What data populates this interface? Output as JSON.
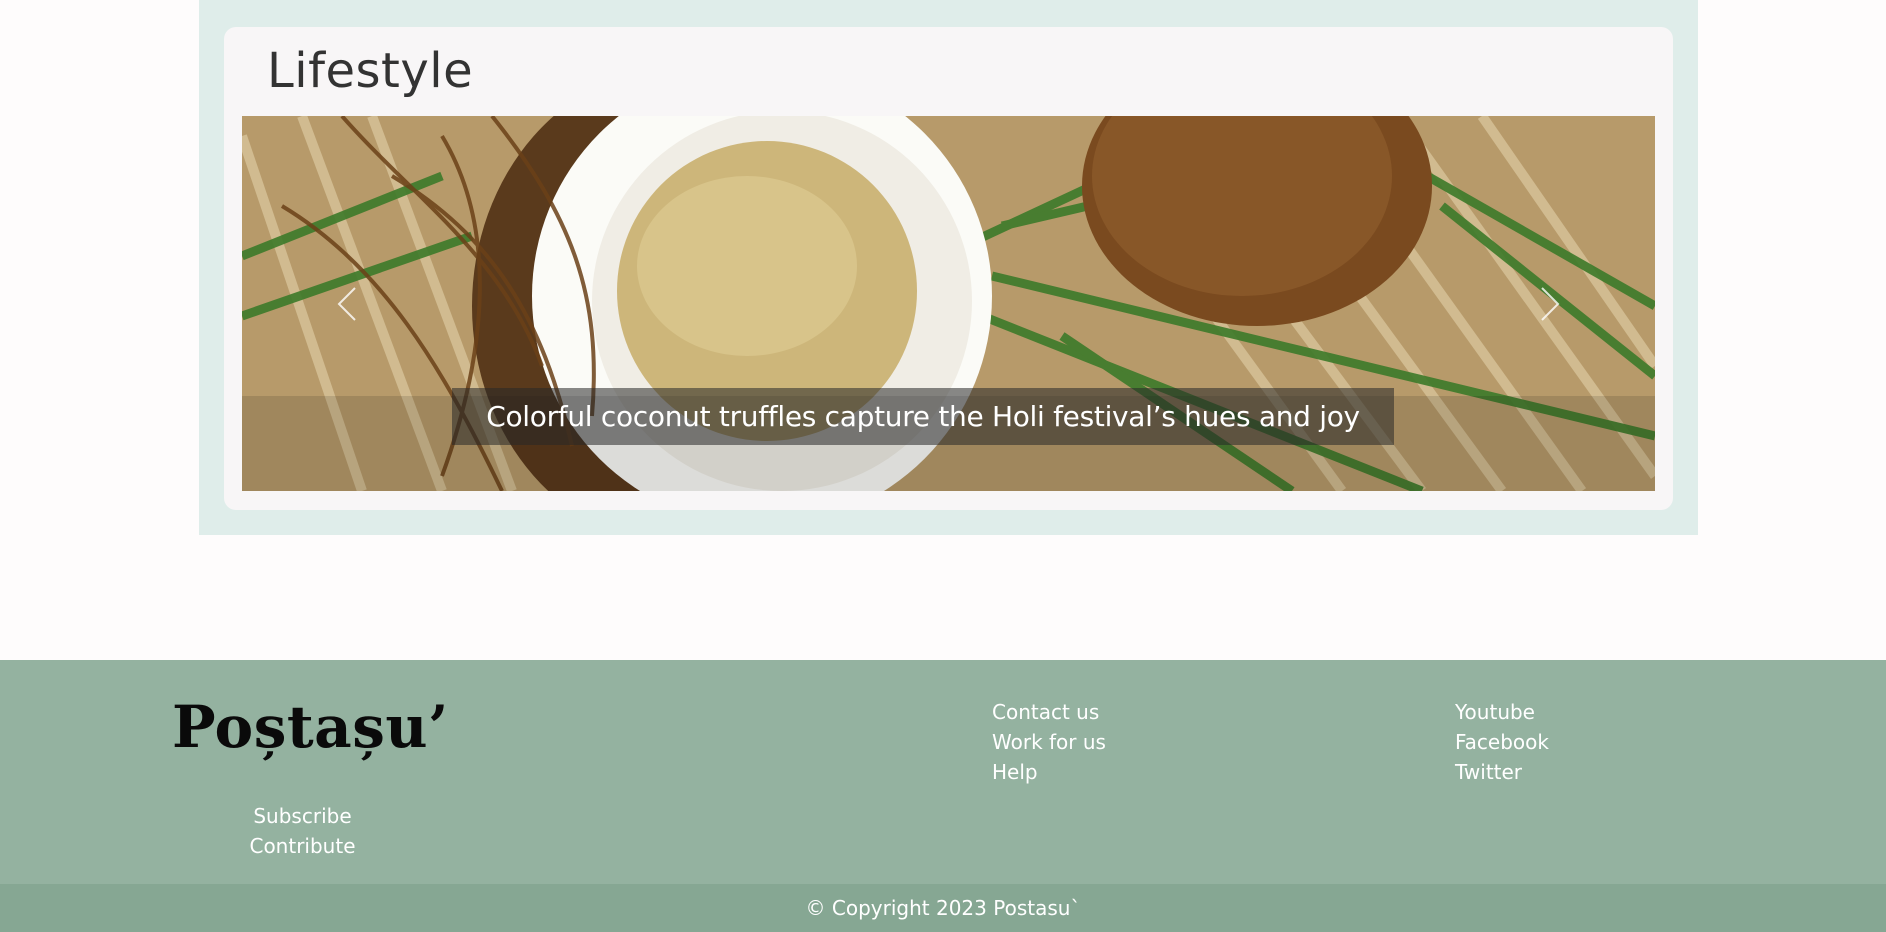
{
  "section": {
    "title": "Lifestyle",
    "carousel": {
      "caption": "Colorful coconut truffles capture the Holi festival’s hues and joy",
      "prev_icon": "chevron-left-icon",
      "next_icon": "chevron-right-icon"
    }
  },
  "footer": {
    "logo": "Poștașu’",
    "left_links": [
      "Subscribe",
      "Contribute"
    ],
    "middle_links": [
      "Contact us",
      "Work for us",
      "Help"
    ],
    "right_links": [
      "Youtube",
      "Facebook",
      "Twitter"
    ],
    "copyright": "© Copyright 2023 Postasu`"
  },
  "colors": {
    "section_bg": "#dfedea",
    "card_bg": "#f8f6f7",
    "footer_bg": "#94b2a0",
    "copyright_bg": "#86a793"
  }
}
